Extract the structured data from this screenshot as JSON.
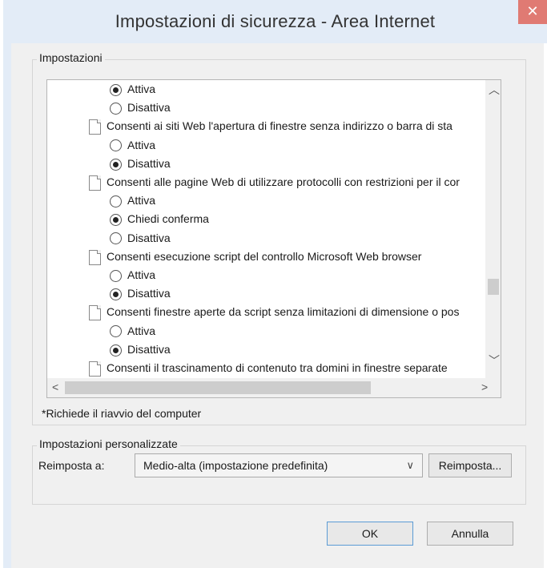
{
  "window": {
    "title": "Impostazioni di sicurezza - Area Internet",
    "close_icon": "close-icon"
  },
  "settings_group": {
    "legend": "Impostazioni"
  },
  "tree_rows": [
    {
      "kind": "radio",
      "checked": true,
      "label": "Attiva"
    },
    {
      "kind": "radio",
      "checked": false,
      "label": "Disattiva"
    },
    {
      "kind": "setting",
      "label": "Consenti ai siti Web l'apertura di finestre senza indirizzo o barra di sta"
    },
    {
      "kind": "radio",
      "checked": false,
      "label": "Attiva"
    },
    {
      "kind": "radio",
      "checked": true,
      "label": "Disattiva"
    },
    {
      "kind": "setting",
      "label": "Consenti alle pagine Web di utilizzare protocolli con restrizioni per il cor"
    },
    {
      "kind": "radio",
      "checked": false,
      "label": "Attiva"
    },
    {
      "kind": "radio",
      "checked": true,
      "label": "Chiedi conferma"
    },
    {
      "kind": "radio",
      "checked": false,
      "label": "Disattiva"
    },
    {
      "kind": "setting",
      "label": "Consenti esecuzione script del controllo Microsoft Web browser"
    },
    {
      "kind": "radio",
      "checked": false,
      "label": "Attiva"
    },
    {
      "kind": "radio",
      "checked": true,
      "label": "Disattiva"
    },
    {
      "kind": "setting",
      "label": "Consenti finestre aperte da script senza limitazioni di dimensione o pos"
    },
    {
      "kind": "radio",
      "checked": false,
      "label": "Attiva"
    },
    {
      "kind": "radio",
      "checked": true,
      "label": "Disattiva"
    },
    {
      "kind": "setting",
      "label": "Consenti il trascinamento di contenuto tra domini in finestre separate"
    }
  ],
  "note": "*Richiede il riavvio del computer",
  "custom_group": {
    "legend": "Impostazioni personalizzate",
    "reset_label": "Reimposta a:",
    "select_value": "Medio-alta (impostazione predefinita)",
    "reset_button": "Reimposta..."
  },
  "footer": {
    "ok": "OK",
    "cancel": "Annulla"
  }
}
